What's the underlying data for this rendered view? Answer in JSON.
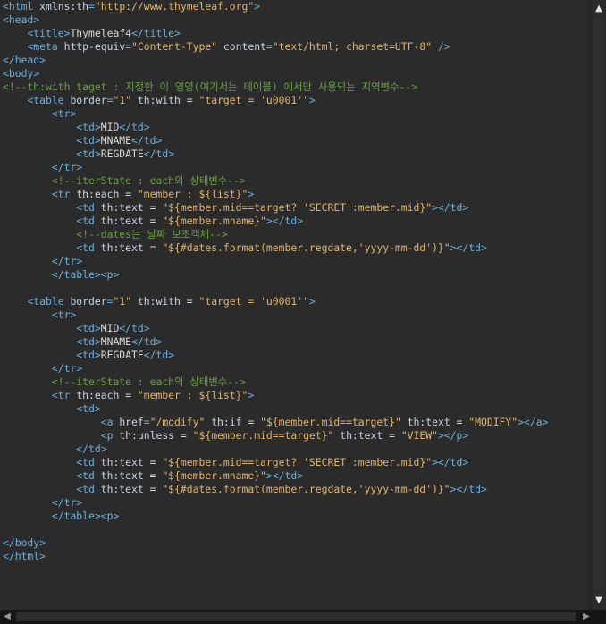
{
  "editor": {
    "lines": [
      [
        [
          "tag",
          "<html "
        ],
        [
          "attr",
          "xmlns:th"
        ],
        [
          "tag",
          "="
        ],
        [
          "val",
          "\"http://www.thymeleaf.org\""
        ],
        [
          "tag",
          ">"
        ]
      ],
      [
        [
          "tag",
          "<head>"
        ]
      ],
      [
        [
          "txt",
          "    "
        ],
        [
          "tag",
          "<title>"
        ],
        [
          "txt",
          "Thymeleaf4"
        ],
        [
          "tag",
          "</title>"
        ]
      ],
      [
        [
          "txt",
          "    "
        ],
        [
          "tag",
          "<meta "
        ],
        [
          "attr",
          "http-equiv"
        ],
        [
          "tag",
          "="
        ],
        [
          "val",
          "\"Content-Type\""
        ],
        [
          "txt",
          " "
        ],
        [
          "attr",
          "content"
        ],
        [
          "tag",
          "="
        ],
        [
          "val",
          "\"text/html; charset=UTF-8\""
        ],
        [
          "txt",
          " "
        ],
        [
          "tag",
          "/>"
        ]
      ],
      [
        [
          "tag",
          "</head>"
        ]
      ],
      [
        [
          "tag",
          "<body>"
        ]
      ],
      [
        [
          "cmt",
          "<!--th:with taget : 지정한 이 영영(여기서는 테이블) 에서만 사용되는 지역변수-->"
        ]
      ],
      [
        [
          "txt",
          "    "
        ],
        [
          "tag",
          "<table "
        ],
        [
          "attr",
          "border"
        ],
        [
          "tag",
          "="
        ],
        [
          "val",
          "\"1\""
        ],
        [
          "txt",
          " "
        ],
        [
          "attr",
          "th:with"
        ],
        [
          "txt",
          " = "
        ],
        [
          "val",
          "\"target = 'u0001'\""
        ],
        [
          "tag",
          ">"
        ]
      ],
      [
        [
          "txt",
          "        "
        ],
        [
          "tag",
          "<tr>"
        ]
      ],
      [
        [
          "txt",
          "            "
        ],
        [
          "tag",
          "<td>"
        ],
        [
          "txt",
          "MID"
        ],
        [
          "tag",
          "</td>"
        ]
      ],
      [
        [
          "txt",
          "            "
        ],
        [
          "tag",
          "<td>"
        ],
        [
          "txt",
          "MNAME"
        ],
        [
          "tag",
          "</td>"
        ]
      ],
      [
        [
          "txt",
          "            "
        ],
        [
          "tag",
          "<td>"
        ],
        [
          "txt",
          "REGDATE"
        ],
        [
          "tag",
          "</td>"
        ]
      ],
      [
        [
          "txt",
          "        "
        ],
        [
          "tag",
          "</tr>"
        ]
      ],
      [
        [
          "txt",
          "        "
        ],
        [
          "cmt",
          "<!--iterState : each의 상태변수-->"
        ]
      ],
      [
        [
          "txt",
          "        "
        ],
        [
          "tag",
          "<tr "
        ],
        [
          "attr",
          "th:each"
        ],
        [
          "txt",
          " = "
        ],
        [
          "val",
          "\"member : ${list}\""
        ],
        [
          "tag",
          ">"
        ]
      ],
      [
        [
          "txt",
          "            "
        ],
        [
          "tag",
          "<td "
        ],
        [
          "attr",
          "th:text"
        ],
        [
          "txt",
          " = "
        ],
        [
          "val",
          "\"${member.mid==target? 'SECRET':member.mid}\""
        ],
        [
          "tag",
          "></td>"
        ]
      ],
      [
        [
          "txt",
          "            "
        ],
        [
          "tag",
          "<td "
        ],
        [
          "attr",
          "th:text"
        ],
        [
          "txt",
          " = "
        ],
        [
          "val",
          "\"${member.mname}\""
        ],
        [
          "tag",
          "></td>"
        ]
      ],
      [
        [
          "txt",
          "            "
        ],
        [
          "cmt",
          "<!--dates는 날짜 보조객체-->"
        ]
      ],
      [
        [
          "txt",
          "            "
        ],
        [
          "tag",
          "<td "
        ],
        [
          "attr",
          "th:text"
        ],
        [
          "txt",
          " = "
        ],
        [
          "val",
          "\"${#dates.format(member.regdate,'yyyy-mm-dd')}\""
        ],
        [
          "tag",
          "></td>"
        ]
      ],
      [
        [
          "txt",
          "        "
        ],
        [
          "tag",
          "</tr>"
        ]
      ],
      [
        [
          "txt",
          "        "
        ],
        [
          "tag",
          "</table><p>"
        ]
      ],
      [
        [
          "txt",
          ""
        ]
      ],
      [
        [
          "txt",
          "    "
        ],
        [
          "tag",
          "<table "
        ],
        [
          "attr",
          "border"
        ],
        [
          "tag",
          "="
        ],
        [
          "val",
          "\"1\""
        ],
        [
          "txt",
          " "
        ],
        [
          "attr",
          "th:with"
        ],
        [
          "txt",
          " = "
        ],
        [
          "val",
          "\"target = 'u0001'\""
        ],
        [
          "tag",
          ">"
        ]
      ],
      [
        [
          "txt",
          "        "
        ],
        [
          "tag",
          "<tr>"
        ]
      ],
      [
        [
          "txt",
          "            "
        ],
        [
          "tag",
          "<td>"
        ],
        [
          "txt",
          "MID"
        ],
        [
          "tag",
          "</td>"
        ]
      ],
      [
        [
          "txt",
          "            "
        ],
        [
          "tag",
          "<td>"
        ],
        [
          "txt",
          "MNAME"
        ],
        [
          "tag",
          "</td>"
        ]
      ],
      [
        [
          "txt",
          "            "
        ],
        [
          "tag",
          "<td>"
        ],
        [
          "txt",
          "REGDATE"
        ],
        [
          "tag",
          "</td>"
        ]
      ],
      [
        [
          "txt",
          "        "
        ],
        [
          "tag",
          "</tr>"
        ]
      ],
      [
        [
          "txt",
          "        "
        ],
        [
          "cmt",
          "<!--iterState : each의 상태변수-->"
        ]
      ],
      [
        [
          "txt",
          "        "
        ],
        [
          "tag",
          "<tr "
        ],
        [
          "attr",
          "th:each"
        ],
        [
          "txt",
          " = "
        ],
        [
          "val",
          "\"member : ${list}\""
        ],
        [
          "tag",
          ">"
        ]
      ],
      [
        [
          "txt",
          "            "
        ],
        [
          "tag",
          "<td>"
        ]
      ],
      [
        [
          "txt",
          "                "
        ],
        [
          "tag",
          "<a "
        ],
        [
          "attr",
          "href"
        ],
        [
          "tag",
          "="
        ],
        [
          "val",
          "\"/modify\""
        ],
        [
          "txt",
          " "
        ],
        [
          "attr",
          "th:if"
        ],
        [
          "txt",
          " = "
        ],
        [
          "val",
          "\"${member.mid==target}\""
        ],
        [
          "txt",
          " "
        ],
        [
          "attr",
          "th:text"
        ],
        [
          "txt",
          " = "
        ],
        [
          "val",
          "\"MODIFY\""
        ],
        [
          "tag",
          "></a>"
        ]
      ],
      [
        [
          "txt",
          "                "
        ],
        [
          "tag",
          "<p "
        ],
        [
          "attr",
          "th:unless"
        ],
        [
          "txt",
          " = "
        ],
        [
          "val",
          "\"${member.mid==target}\""
        ],
        [
          "txt",
          " "
        ],
        [
          "attr",
          "th:text"
        ],
        [
          "txt",
          " = "
        ],
        [
          "val",
          "\"VIEW\""
        ],
        [
          "tag",
          "></p>"
        ]
      ],
      [
        [
          "txt",
          "            "
        ],
        [
          "tag",
          "</td>"
        ]
      ],
      [
        [
          "txt",
          "            "
        ],
        [
          "tag",
          "<td "
        ],
        [
          "attr",
          "th:text"
        ],
        [
          "txt",
          " = "
        ],
        [
          "val",
          "\"${member.mid==target? 'SECRET':member.mid}\""
        ],
        [
          "tag",
          "></td>"
        ]
      ],
      [
        [
          "txt",
          "            "
        ],
        [
          "tag",
          "<td "
        ],
        [
          "attr",
          "th:text"
        ],
        [
          "txt",
          " = "
        ],
        [
          "val",
          "\"${member.mname}\""
        ],
        [
          "tag",
          "></td>"
        ]
      ],
      [
        [
          "txt",
          "            "
        ],
        [
          "tag",
          "<td "
        ],
        [
          "attr",
          "th:text"
        ],
        [
          "txt",
          " = "
        ],
        [
          "val",
          "\"${#dates.format(member.regdate,'yyyy-mm-dd')}\""
        ],
        [
          "tag",
          "></td>"
        ]
      ],
      [
        [
          "txt",
          "        "
        ],
        [
          "tag",
          "</tr>"
        ]
      ],
      [
        [
          "txt",
          "        "
        ],
        [
          "tag",
          "</table><p>"
        ]
      ],
      [
        [
          "txt",
          ""
        ]
      ],
      [
        [
          "tag",
          "</body>"
        ]
      ],
      [
        [
          "tag",
          "</html>"
        ]
      ]
    ],
    "cursor_line": 42
  },
  "scrollbars": {
    "up_icon": "▲",
    "down_icon": "▼",
    "left_icon": "◀",
    "right_icon": "▶"
  }
}
